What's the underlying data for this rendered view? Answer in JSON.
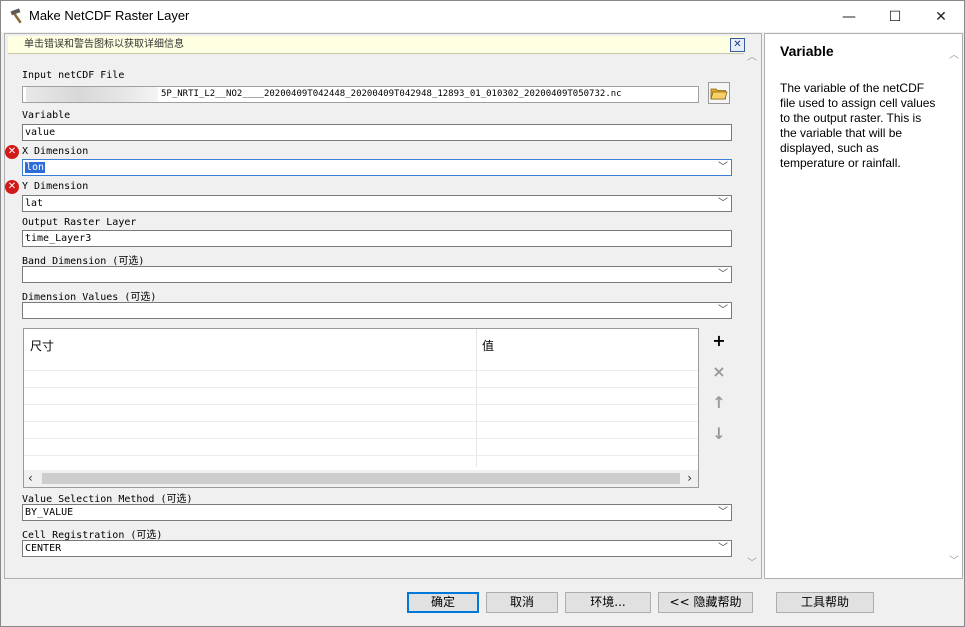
{
  "window": {
    "title": "Make NetCDF Raster Layer",
    "minimize": "—",
    "maximize": "☐",
    "close": "✕"
  },
  "message_bar": {
    "text": "单击错误和警告图标以获取详细信息",
    "close": "✕"
  },
  "form": {
    "input_file": {
      "label": "Input netCDF File",
      "value": "5P_NRTI_L2__NO2____20200409T042448_20200409T042948_12893_01_010302_20200409T050732.nc"
    },
    "variable": {
      "label": "Variable",
      "value": "value"
    },
    "x_dimension": {
      "label": "X Dimension",
      "value": "lon",
      "error": true
    },
    "y_dimension": {
      "label": "Y Dimension",
      "value": "lat",
      "error": true
    },
    "output_layer": {
      "label": "Output Raster Layer",
      "value": "time_Layer3"
    },
    "band_dimension": {
      "label": "Band Dimension (可选)",
      "value": ""
    },
    "dimension_values": {
      "label": "Dimension Values (可选)",
      "value": "",
      "columns": [
        "尺寸",
        "值"
      ],
      "rows": []
    },
    "value_selection": {
      "label": "Value Selection Method (可选)",
      "value": "BY_VALUE"
    },
    "cell_registration": {
      "label": "Cell Registration (可选)",
      "value": "CENTER"
    }
  },
  "side_buttons": {
    "add": "+",
    "delete": "×",
    "up": "↑",
    "down": "↓"
  },
  "buttons": {
    "ok": "确定",
    "cancel": "取消",
    "environments": "环境...",
    "hide_help": "<< 隐藏帮助",
    "tool_help": "工具帮助"
  },
  "help": {
    "title": "Variable",
    "text": "The variable of the netCDF file used to assign cell values to the output raster. This is the variable that will be displayed, such as temperature or rainfall."
  },
  "icons": {
    "error": "error-x-circle",
    "folder": "open-folder",
    "app": "hammer-tool"
  },
  "colors": {
    "error": "#d11a1a",
    "selection": "#2b6cd8",
    "message_bg": "#ffffe1",
    "focus_border": "#3c7fd6"
  }
}
